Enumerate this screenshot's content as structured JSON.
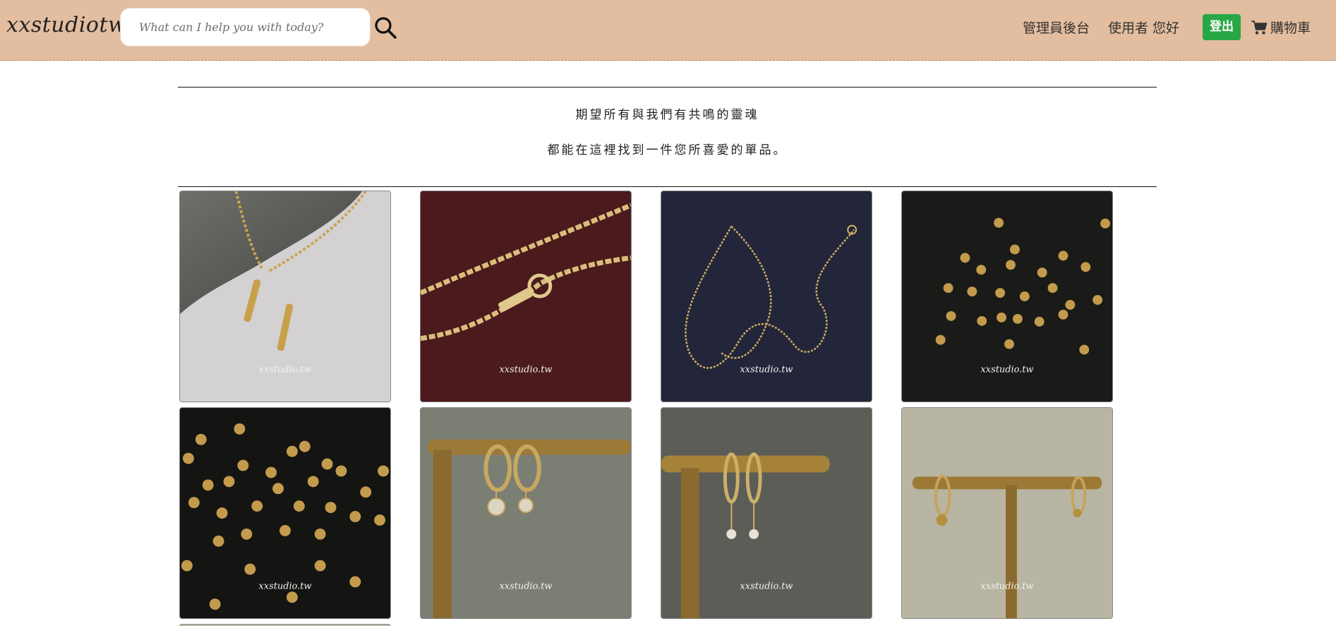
{
  "header": {
    "brand": "xxstudiotw",
    "search_placeholder": "What can I help you with today?",
    "admin_link": "管理員後台",
    "user_greeting": "使用者 您好",
    "logout_label": "登出",
    "cart_label": "購物車",
    "logout_color": "#28a745",
    "background_color": "#e3bd9f"
  },
  "intro": {
    "line1": "期望所有與我們有共鳴的靈魂",
    "line2": "都能在這裡找到一件您所喜愛的單品。"
  },
  "products": [
    {
      "image": "gold bar pendant necklace on grey stone"
    },
    {
      "image": "gold chain with clasp on burgundy background"
    },
    {
      "image": "thin gold chain on navy background"
    },
    {
      "image": "gold spacer beads on black background"
    },
    {
      "image": "gold spacer beads scattered on black background"
    },
    {
      "image": "gold hoop earrings with crystal charms on stand"
    },
    {
      "image": "gold huggie earrings with star charms on stand"
    },
    {
      "image": "gold hoop earrings on T-bar stand"
    }
  ],
  "watermark": "xxstudio.tw"
}
